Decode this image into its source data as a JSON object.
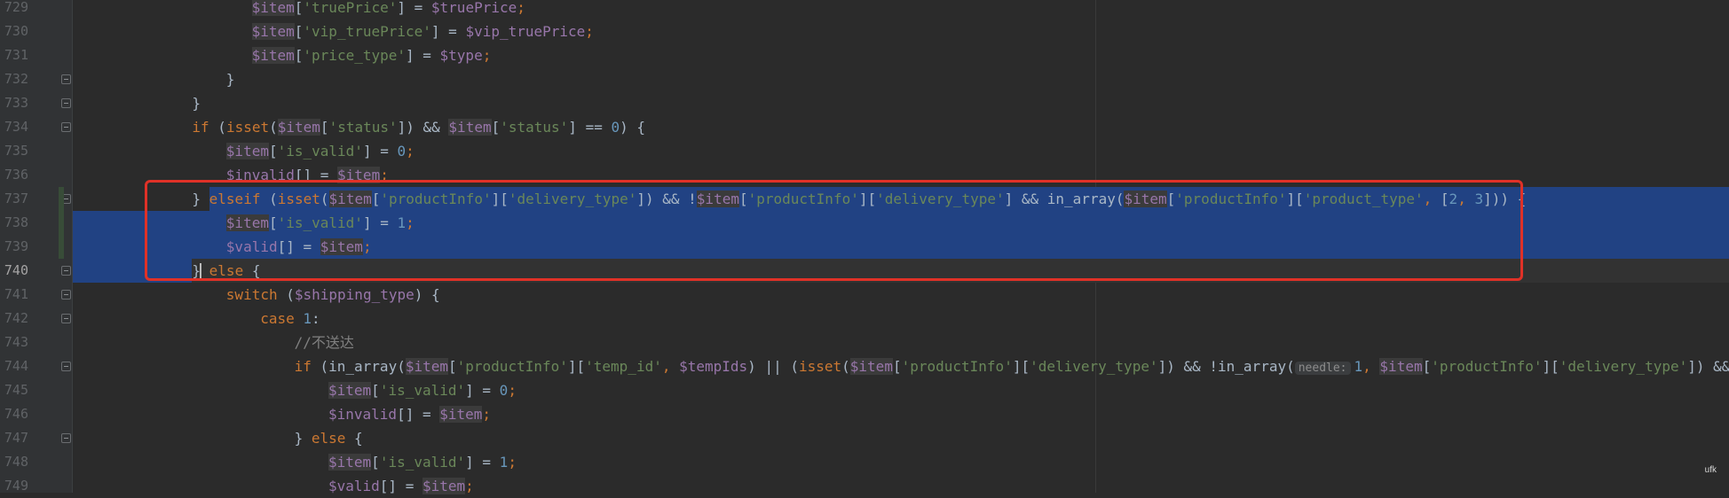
{
  "editor": {
    "current_line": "740",
    "watermark": "ufk"
  },
  "lines": [
    {
      "num": "729",
      "tokens": [
        [
          "var",
          "$item"
        ],
        [
          "pl",
          "["
        ],
        [
          "str",
          "'truePrice'"
        ],
        [
          "pl",
          "] = "
        ],
        [
          "var",
          "$truePrice"
        ],
        [
          "kw",
          ";"
        ]
      ]
    },
    {
      "num": "730",
      "tokens": [
        [
          "var",
          "$item"
        ],
        [
          "pl",
          "["
        ],
        [
          "str",
          "'vip_truePrice'"
        ],
        [
          "pl",
          "] = "
        ],
        [
          "var",
          "$vip_truePrice"
        ],
        [
          "kw",
          ";"
        ]
      ]
    },
    {
      "num": "731",
      "tokens": [
        [
          "var",
          "$item"
        ],
        [
          "pl",
          "["
        ],
        [
          "str",
          "'price_type'"
        ],
        [
          "pl",
          "] = "
        ],
        [
          "var",
          "$type"
        ],
        [
          "kw",
          ";"
        ]
      ]
    },
    {
      "num": "732",
      "tokens": [
        [
          "pl",
          "}"
        ]
      ]
    },
    {
      "num": "733",
      "tokens": [
        [
          "pl",
          "}"
        ]
      ]
    },
    {
      "num": "734",
      "tokens": [
        [
          "kw",
          "if "
        ],
        [
          "pl",
          "("
        ],
        [
          "kw",
          "isset"
        ],
        [
          "pl",
          "("
        ],
        [
          "var",
          "$item"
        ],
        [
          "pl",
          "["
        ],
        [
          "str",
          "'status'"
        ],
        [
          "pl",
          "]) && "
        ],
        [
          "var",
          "$item"
        ],
        [
          "pl",
          "["
        ],
        [
          "str",
          "'status'"
        ],
        [
          "pl",
          "] == "
        ],
        [
          "num",
          "0"
        ],
        [
          "pl",
          ") {"
        ]
      ]
    },
    {
      "num": "735",
      "tokens": [
        [
          "var",
          "$item"
        ],
        [
          "pl",
          "["
        ],
        [
          "str",
          "'is_valid'"
        ],
        [
          "pl",
          "] = "
        ],
        [
          "num",
          "0"
        ],
        [
          "kw",
          ";"
        ]
      ]
    },
    {
      "num": "736",
      "tokens": [
        [
          "var",
          "$invalid"
        ],
        [
          "pl",
          "[] = "
        ],
        [
          "var",
          "$item"
        ],
        [
          "kw",
          ";"
        ]
      ]
    },
    {
      "num": "737",
      "tokens": [
        [
          "pl",
          "} "
        ],
        [
          "kw",
          "elseif "
        ],
        [
          "pl",
          "("
        ],
        [
          "kw",
          "isset"
        ],
        [
          "pl",
          "("
        ],
        [
          "var",
          "$item"
        ],
        [
          "pl",
          "["
        ],
        [
          "str",
          "'productInfo'"
        ],
        [
          "pl",
          "]["
        ],
        [
          "str",
          "'delivery_type'"
        ],
        [
          "pl",
          "]) && !"
        ],
        [
          "var",
          "$item"
        ],
        [
          "pl",
          "["
        ],
        [
          "str",
          "'productInfo'"
        ],
        [
          "pl",
          "]["
        ],
        [
          "str",
          "'delivery_type'"
        ],
        [
          "pl",
          "] && in_array("
        ],
        [
          "var",
          "$item"
        ],
        [
          "pl",
          "["
        ],
        [
          "str",
          "'productInfo'"
        ],
        [
          "pl",
          "]["
        ],
        [
          "str",
          "'product_type'"
        ],
        [
          "kw",
          ", "
        ],
        [
          "pl",
          "["
        ],
        [
          "num",
          "2"
        ],
        [
          "kw",
          ", "
        ],
        [
          "num",
          "3"
        ],
        [
          "pl",
          "])) {"
        ]
      ]
    },
    {
      "num": "738",
      "tokens": [
        [
          "var",
          "$item"
        ],
        [
          "pl",
          "["
        ],
        [
          "str",
          "'is_valid'"
        ],
        [
          "pl",
          "] = "
        ],
        [
          "num",
          "1"
        ],
        [
          "kw",
          ";"
        ]
      ]
    },
    {
      "num": "739",
      "tokens": [
        [
          "var",
          "$valid"
        ],
        [
          "pl",
          "[] = "
        ],
        [
          "var",
          "$item"
        ],
        [
          "kw",
          ";"
        ]
      ]
    },
    {
      "num": "740",
      "tokens": [
        [
          "pl",
          "}"
        ],
        [
          "caret",
          ""
        ],
        [
          "kw",
          " else "
        ],
        [
          "pl",
          "{"
        ]
      ]
    },
    {
      "num": "741",
      "tokens": [
        [
          "kw",
          "switch "
        ],
        [
          "pl",
          "("
        ],
        [
          "var",
          "$shipping_type"
        ],
        [
          "pl",
          ") {"
        ]
      ]
    },
    {
      "num": "742",
      "tokens": [
        [
          "kw",
          "case "
        ],
        [
          "num",
          "1"
        ],
        [
          "pl",
          ":"
        ]
      ]
    },
    {
      "num": "743",
      "tokens": [
        [
          "cm",
          "//不送达"
        ]
      ]
    },
    {
      "num": "744",
      "tokens": [
        [
          "kw",
          "if "
        ],
        [
          "pl",
          "(in_array("
        ],
        [
          "var",
          "$item"
        ],
        [
          "pl",
          "["
        ],
        [
          "str",
          "'productInfo'"
        ],
        [
          "pl",
          "]["
        ],
        [
          "str",
          "'temp_id'"
        ],
        [
          "kw",
          ", "
        ],
        [
          "var",
          "$tempIds"
        ],
        [
          "pl",
          ") || ("
        ],
        [
          "kw",
          "isset"
        ],
        [
          "pl",
          "("
        ],
        [
          "var",
          "$item"
        ],
        [
          "pl",
          "["
        ],
        [
          "str",
          "'productInfo'"
        ],
        [
          "pl",
          "]["
        ],
        [
          "str",
          "'delivery_type'"
        ],
        [
          "pl",
          "]) && !in_array("
        ],
        [
          "hint",
          "needle:"
        ],
        [
          "num",
          "1"
        ],
        [
          "kw",
          ", "
        ],
        [
          "var",
          "$item"
        ],
        [
          "pl",
          "["
        ],
        [
          "str",
          "'productInfo'"
        ],
        [
          "pl",
          "]["
        ],
        [
          "str",
          "'delivery_type'"
        ],
        [
          "pl",
          "]) && !"
        ]
      ]
    },
    {
      "num": "745",
      "tokens": [
        [
          "var",
          "$item"
        ],
        [
          "pl",
          "["
        ],
        [
          "str",
          "'is_valid'"
        ],
        [
          "pl",
          "] = "
        ],
        [
          "num",
          "0"
        ],
        [
          "kw",
          ";"
        ]
      ]
    },
    {
      "num": "746",
      "tokens": [
        [
          "var",
          "$invalid"
        ],
        [
          "pl",
          "[] = "
        ],
        [
          "var",
          "$item"
        ],
        [
          "kw",
          ";"
        ]
      ]
    },
    {
      "num": "747",
      "tokens": [
        [
          "pl",
          "} "
        ],
        [
          "kw",
          "else "
        ],
        [
          "pl",
          "{"
        ]
      ]
    },
    {
      "num": "748",
      "tokens": [
        [
          "var",
          "$item"
        ],
        [
          "pl",
          "["
        ],
        [
          "str",
          "'is_valid'"
        ],
        [
          "pl",
          "] = "
        ],
        [
          "num",
          "1"
        ],
        [
          "kw",
          ";"
        ]
      ]
    },
    {
      "num": "749",
      "tokens": [
        [
          "var",
          "$valid"
        ],
        [
          "pl",
          "[] = "
        ],
        [
          "var",
          "$item"
        ],
        [
          "kw",
          ";"
        ]
      ]
    }
  ]
}
